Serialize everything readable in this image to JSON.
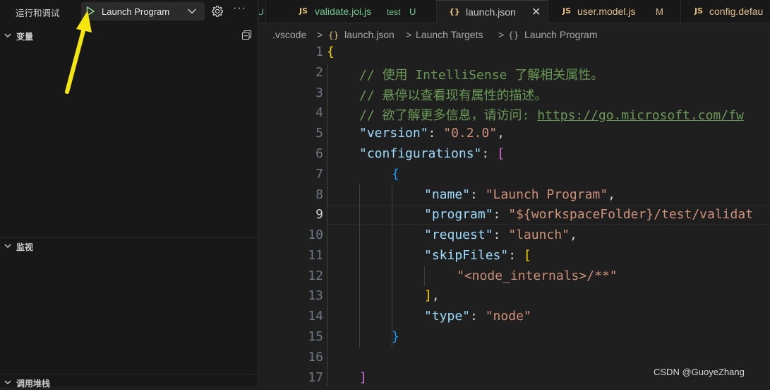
{
  "debug_panel": {
    "title": "运行和调试",
    "launch_config": "Launch Program",
    "more_label": "···",
    "sections": {
      "variables": "变量",
      "watch": "监视",
      "call_stack": "调用堆栈"
    }
  },
  "tabs": [
    {
      "name": "U",
      "icon": "",
      "desc": "",
      "badge": ""
    },
    {
      "name": "validate.joi.js",
      "icon": "JS",
      "desc": "test",
      "badge": "U"
    },
    {
      "name": "launch.json",
      "icon": "{}",
      "desc": "",
      "badge": "",
      "active": true,
      "close": "✕"
    },
    {
      "name": "user.model.js",
      "icon": "JS",
      "desc": "",
      "badge": "M"
    },
    {
      "name": "config.defau",
      "icon": "JS",
      "desc": "",
      "badge": ""
    }
  ],
  "breadcrumb": {
    "items": [
      ".vscode",
      "launch.json",
      "Launch Targets",
      "Launch Program"
    ],
    "sep": ">",
    "json_icon": "{}",
    "obj_icon": "{}"
  },
  "editor": {
    "current_line": 9,
    "line_numbers": [
      "1",
      "2",
      "3",
      "4",
      "5",
      "6",
      "7",
      "8",
      "9",
      "10",
      "11",
      "12",
      "13",
      "14",
      "15",
      "16",
      "17"
    ],
    "lines": {
      "l1_open": "{",
      "l2_comment": "// 使用 IntelliSense 了解相关属性。",
      "l3_comment": "// 悬停以查看现有属性的描述。",
      "l4_comment": "// 欲了解更多信息，请访问: ",
      "l4_url": "https://go.microsoft.com/fw",
      "l5_key": "\"version\"",
      "l5_val": "\"0.2.0\"",
      "l6_key": "\"configurations\"",
      "l6_bracket": "[",
      "l7_open": "{",
      "l8_key": "\"name\"",
      "l8_val": "\"Launch Program\"",
      "l9_key": "\"program\"",
      "l9_val_a": "\"${workspaceFolder}",
      "l9_val_b": "/test/validat",
      "l10_key": "\"request\"",
      "l10_val": "\"launch\"",
      "l11_key": "\"skipFiles\"",
      "l11_bracket": "[",
      "l12_val": "\"<node_internals>/**\"",
      "l13_close": "]",
      "l14_key": "\"type\"",
      "l14_val": "\"node\"",
      "l15_close": "}",
      "l17_close": "]"
    },
    "colon": ": ",
    "comma": ","
  },
  "watermark": "CSDN @GuoyeZhang",
  "colors": {
    "background": "#1f1f1f",
    "sidebar": "#181818",
    "annotation_arrow": "#f5e60c",
    "json_key": "#9cdcfe",
    "json_string": "#ce9178",
    "comment": "#6a9955"
  }
}
